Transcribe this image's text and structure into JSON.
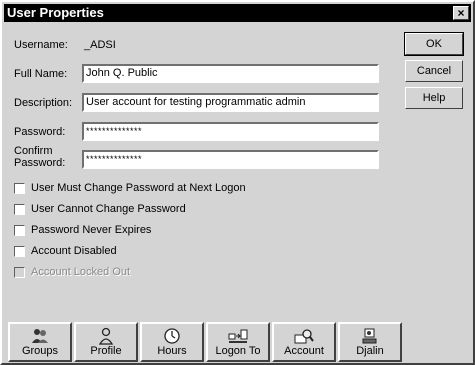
{
  "window": {
    "title": "User Properties",
    "close_glyph": "×"
  },
  "fields": {
    "username_label": "Username:",
    "username_value": "_ADSI",
    "fullname_label": "Full Name:",
    "fullname_value": "John Q. Public",
    "description_label": "Description:",
    "description_value": "User account for testing programmatic admin",
    "password_label": "Password:",
    "password_value": "**************",
    "confirm_label_1": "Confirm",
    "confirm_label_2": "Password:",
    "confirm_value": "**************"
  },
  "buttons": {
    "ok": "OK",
    "cancel": "Cancel",
    "help": "Help"
  },
  "checkboxes": [
    {
      "label": "User Must Change Password at Next Logon",
      "checked": false,
      "enabled": true
    },
    {
      "label": "User Cannot Change Password",
      "checked": false,
      "enabled": true
    },
    {
      "label": "Password Never Expires",
      "checked": false,
      "enabled": true
    },
    {
      "label": "Account Disabled",
      "checked": false,
      "enabled": true
    },
    {
      "label": "Account Locked Out",
      "checked": false,
      "enabled": false
    }
  ],
  "tabs": [
    {
      "label": "Groups",
      "icon": "groups-icon"
    },
    {
      "label": "Profile",
      "icon": "profile-icon"
    },
    {
      "label": "Hours",
      "icon": "clock-icon"
    },
    {
      "label": "Logon To",
      "icon": "workstations-icon"
    },
    {
      "label": "Account",
      "icon": "account-search-icon"
    },
    {
      "label": "Djalin",
      "icon": "dialin-icon"
    }
  ]
}
